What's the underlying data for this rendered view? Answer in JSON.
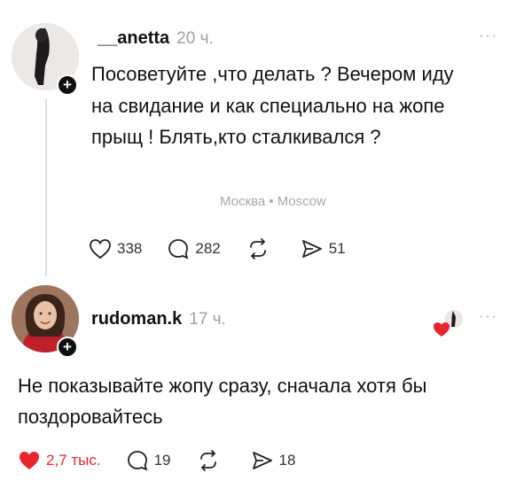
{
  "post1": {
    "username": "__anetta",
    "time": "20 ч.",
    "more": "···",
    "text": "Посоветуйте ,что делать ? Вечером иду на свидание и как специально на жопе прыщ ! Блять,кто сталкивался ?",
    "location": "Москва • Moscow",
    "actions": {
      "likes": "338",
      "comments": "282",
      "shares": "51"
    }
  },
  "post2": {
    "username": "rudoman.k",
    "time": "17 ч.",
    "more": "···",
    "text": "Не показывайте жопу сразу, сначала хотя бы поздоровайтесь",
    "actions": {
      "likes": "2,7 тыс.",
      "comments": "19",
      "shares": "18"
    }
  },
  "colors": {
    "like_red": "#e8242e",
    "muted": "#a0a0a0",
    "text": "#111111"
  }
}
